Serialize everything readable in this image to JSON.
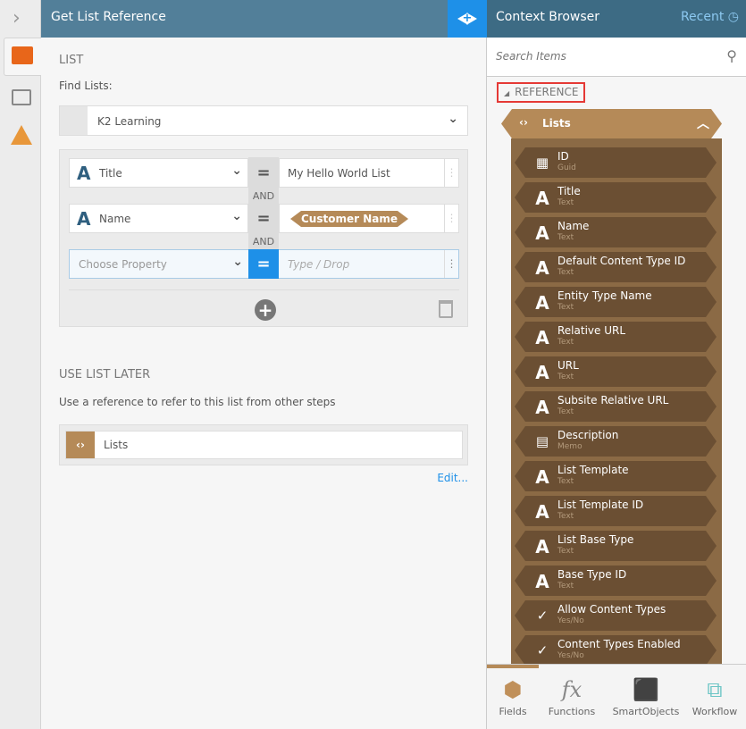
{
  "left_panel": {
    "title": "Get List Reference",
    "section_list": "LIST",
    "find_lists_label": "Find Lists:",
    "site_value": "K2 Learning",
    "filters": [
      {
        "property": "Title",
        "operator": "=",
        "value": "My Hello World List",
        "value_type": "text"
      },
      {
        "joiner": "AND",
        "property": "Name",
        "operator": "=",
        "value": "Customer Name",
        "value_type": "token"
      },
      {
        "joiner": "AND",
        "property_placeholder": "Choose Property",
        "operator": "=",
        "value_placeholder": "Type / Drop"
      }
    ],
    "section_later": "USE LIST LATER",
    "later_desc": "Use a reference to refer to this list from other steps",
    "reference_value": "Lists",
    "edit_link": "Edit..."
  },
  "right_panel": {
    "title": "Context Browser",
    "recent_label": "Recent",
    "search_placeholder": "Search Items",
    "reference_label": "REFERENCE",
    "group_label": "Lists",
    "items": [
      {
        "name": "ID",
        "type": "Guid",
        "icon": "grid"
      },
      {
        "name": "Title",
        "type": "Text",
        "icon": "A"
      },
      {
        "name": "Name",
        "type": "Text",
        "icon": "A"
      },
      {
        "name": "Default Content Type ID",
        "type": "Text",
        "icon": "A"
      },
      {
        "name": "Entity Type Name",
        "type": "Text",
        "icon": "A"
      },
      {
        "name": "Relative URL",
        "type": "Text",
        "icon": "A"
      },
      {
        "name": "URL",
        "type": "Text",
        "icon": "A"
      },
      {
        "name": "Subsite Relative URL",
        "type": "Text",
        "icon": "A"
      },
      {
        "name": "Description",
        "type": "Memo",
        "icon": "memo"
      },
      {
        "name": "List Template",
        "type": "Text",
        "icon": "A"
      },
      {
        "name": "List Template ID",
        "type": "Text",
        "icon": "A"
      },
      {
        "name": "List Base Type",
        "type": "Text",
        "icon": "A"
      },
      {
        "name": "Base Type ID",
        "type": "Text",
        "icon": "A"
      },
      {
        "name": "Allow Content Types",
        "type": "Yes/No",
        "icon": "yesno"
      },
      {
        "name": "Content Types Enabled",
        "type": "Yes/No",
        "icon": "yesno"
      }
    ],
    "bottom_tabs": [
      {
        "label": "Fields"
      },
      {
        "label": "Functions"
      },
      {
        "label": "SmartObjects"
      },
      {
        "label": "Workflow"
      }
    ]
  },
  "colors": {
    "header": "#527f99",
    "accent": "#1e90e8",
    "tan": "#b58a58",
    "brown": "#6b4f33"
  }
}
